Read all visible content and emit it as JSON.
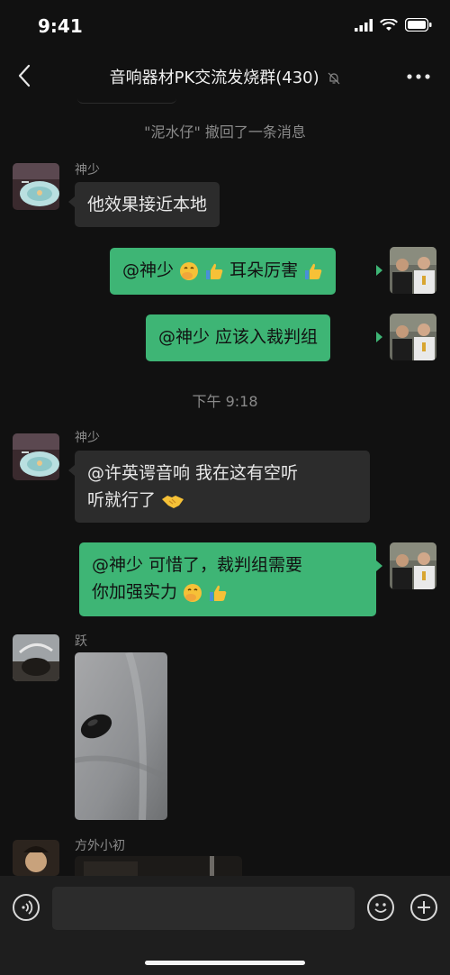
{
  "status_bar": {
    "time": "9:41"
  },
  "header": {
    "title": "音响器材PK交流发烧群(430)"
  },
  "messages": {
    "recall_notice": "\"泥水仔\" 撤回了一条消息",
    "m1_sender": "神少",
    "m1_text": "他效果接近本地",
    "m2_text_a": "@神少 ",
    "m2_text_b": "耳朵厉害",
    "m3_text": "@神少 应该入裁判组",
    "time_divider": "下午 9:18",
    "m4_sender": "神少",
    "m4_line1": "@许英谔音响 我在这有空听",
    "m4_line2": "听就行了",
    "m5_line1": "@神少 可惜了，裁判组需要",
    "m5_line2": "你加强实力",
    "m6_sender": "跃",
    "m7_sender": "方外小初"
  },
  "icons": {
    "emoji": [
      "hand-over-mouth",
      "thumbs-up",
      "handshake"
    ],
    "toolbar": [
      "voice-icon",
      "emoji-icon",
      "plus-icon"
    ]
  },
  "colors": {
    "bubble_out": "#3eb575",
    "bubble_in": "#2c2c2c",
    "background": "#111111"
  }
}
